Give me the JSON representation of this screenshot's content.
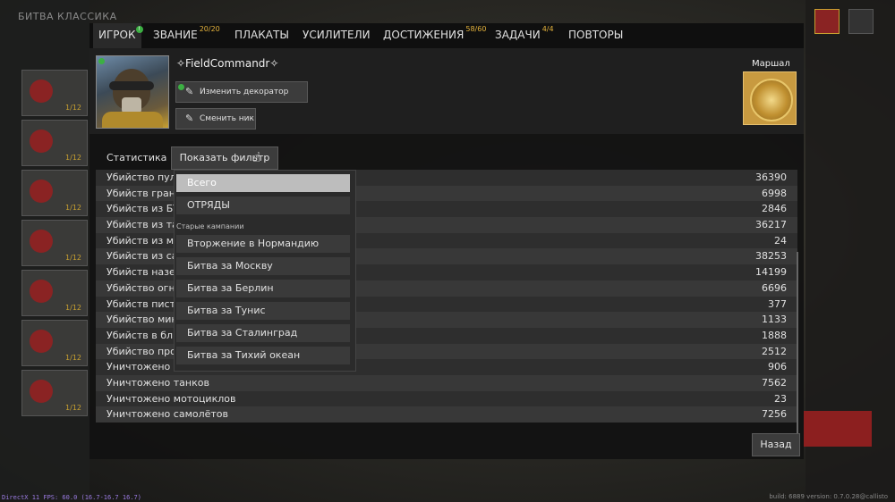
{
  "tabs": [
    {
      "label": "ИГРОК",
      "badge": ""
    },
    {
      "label": "ЗВАНИЕ",
      "badge": "20/20"
    },
    {
      "label": "ПЛАКАТЫ",
      "badge": ""
    },
    {
      "label": "УСИЛИТЕЛИ",
      "badge": ""
    },
    {
      "label": "ДОСТИЖЕНИЯ",
      "badge": "58/60"
    },
    {
      "label": "ЗАДАЧИ",
      "badge": "4/4"
    },
    {
      "label": "ПОВТОРЫ",
      "badge": ""
    }
  ],
  "notice_dot": "!",
  "player": {
    "nickname": "✧FieldCommandr✧",
    "change_decorator_label": "Изменить декоратор имени",
    "change_nick_label": "Сменить ник",
    "rank_label": "Маршал"
  },
  "stats": {
    "heading": "Статистика",
    "filter_label": "Показать фильтр",
    "rows": [
      {
        "label": "Убийство пулеметом",
        "value": "36390"
      },
      {
        "label": "Убийств гранатой",
        "value": "6998"
      },
      {
        "label": "Убийств из БТР",
        "value": "2846"
      },
      {
        "label": "Убийств из танка",
        "value": "36217"
      },
      {
        "label": "Убийств из мотоцикла",
        "value": "24"
      },
      {
        "label": "Убийств из самолёта",
        "value": "38253"
      },
      {
        "label": "Убийств наземной техники",
        "value": "14199"
      },
      {
        "label": "Убийство огнеметом",
        "value": "6696"
      },
      {
        "label": "Убийств пистолетом",
        "value": "377"
      },
      {
        "label": "Убийство миной",
        "value": "1133"
      },
      {
        "label": "Убийств в ближнем бою",
        "value": "1888"
      },
      {
        "label": "Убийство противотанковым",
        "value": "2512"
      },
      {
        "label": "Уничтожено БТР",
        "value": "906"
      },
      {
        "label": "Уничтожено танков",
        "value": "7562"
      },
      {
        "label": "Уничтожено мотоциклов",
        "value": "23"
      },
      {
        "label": "Уничтожено самолётов",
        "value": "7256"
      }
    ]
  },
  "filter_menu": {
    "items_top": [
      "Всего",
      "ОТРЯДЫ"
    ],
    "section_label": "Старые кампании",
    "campaigns": [
      "Вторжение в Нормандию",
      "Битва за Москву",
      "Битва за Берлин",
      "Битва за Тунис",
      "Битва за Сталинград",
      "Битва за Тихий океан"
    ],
    "selected": "Всего"
  },
  "back_label": "Назад",
  "background": {
    "top_tabs": "БИТВА   КЛАССИКА",
    "fps_text": "DirectX 11 FPS: 60.0 (16.7-16.7 16.7)",
    "build_text": "build: 6889 version: 0.7.0.28@callisto"
  },
  "colors": {
    "badge_gold": "#e4b23c",
    "notice_green": "#3cb043",
    "panel_bg": "#121212",
    "accent_red": "#8c1f1f"
  }
}
